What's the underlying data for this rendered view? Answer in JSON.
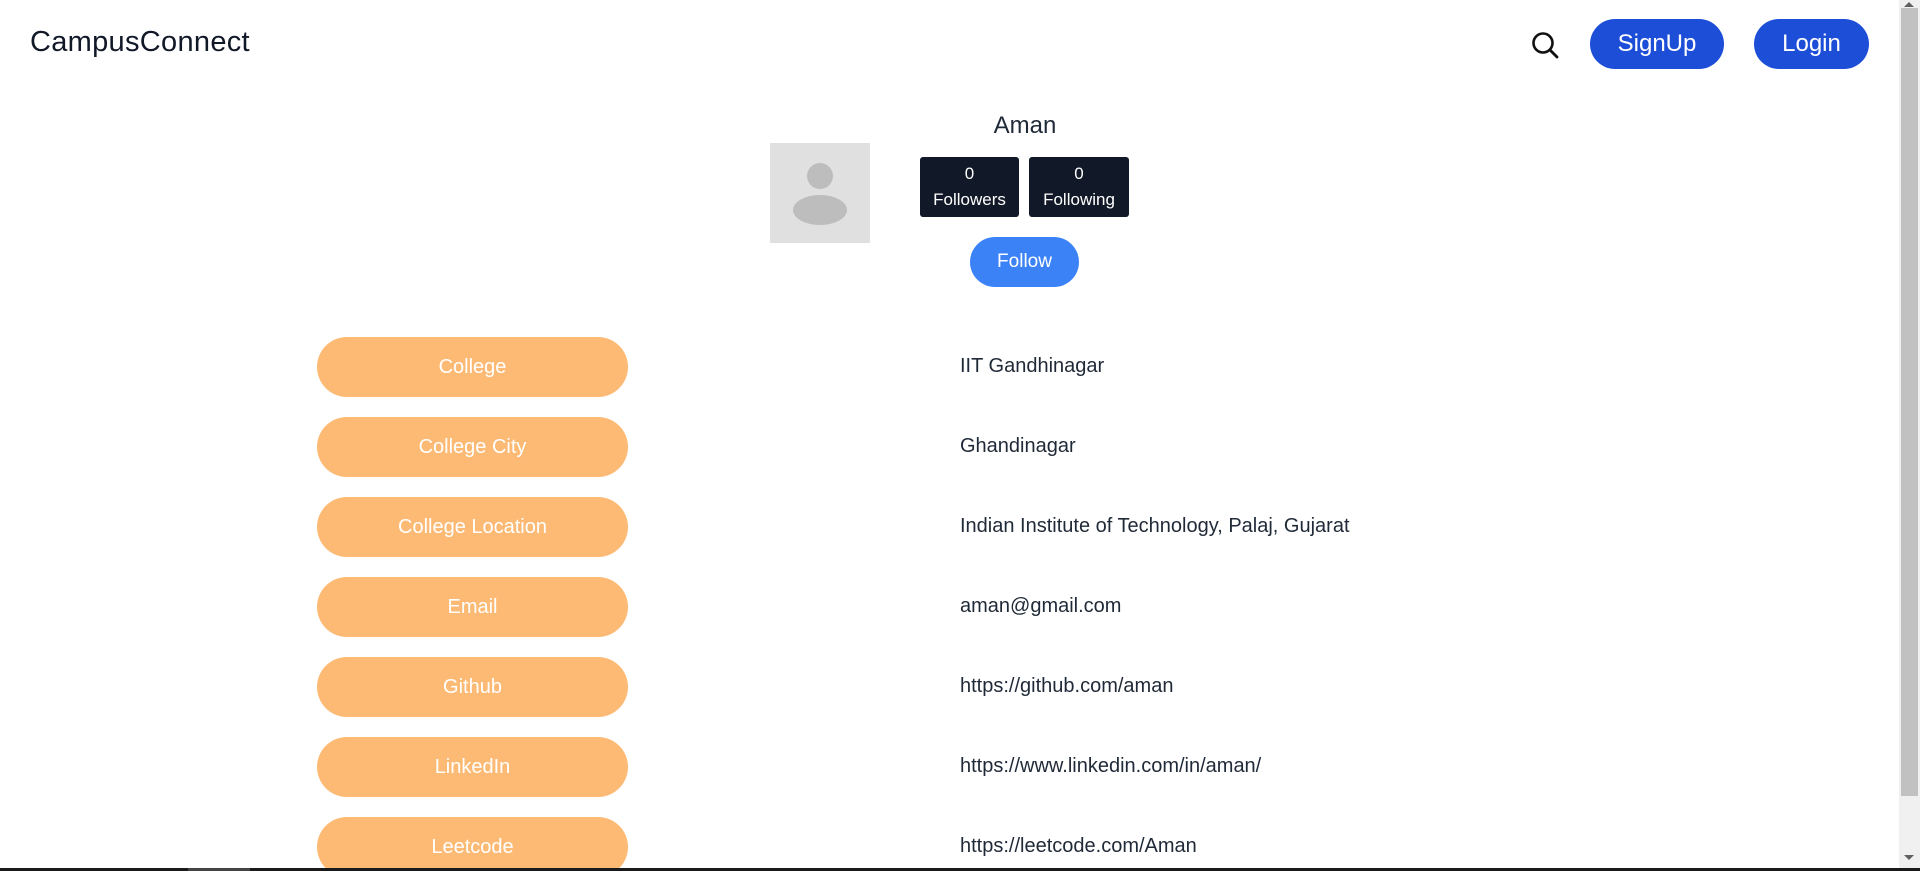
{
  "header": {
    "brand": "CampusConnect",
    "search_icon": "search-icon",
    "signup_label": "SignUp",
    "login_label": "Login"
  },
  "profile": {
    "name": "Aman",
    "avatar_icon": "user-placeholder-icon",
    "followers_count": "0",
    "followers_label": "Followers",
    "following_count": "0",
    "following_label": "Following",
    "follow_label": "Follow"
  },
  "details": [
    {
      "label": "College",
      "value": "IIT Gandhinagar"
    },
    {
      "label": "College City",
      "value": "Ghandinagar"
    },
    {
      "label": "College Location",
      "value": "Indian Institute of Technology, Palaj, Gujarat"
    },
    {
      "label": "Email",
      "value": "aman@gmail.com"
    },
    {
      "label": "Github",
      "value": "https://github.com/aman"
    },
    {
      "label": "LinkedIn",
      "value": "https://www.linkedin.com/in/aman/"
    },
    {
      "label": "Leetcode",
      "value": "https://leetcode.com/Aman"
    }
  ],
  "colors": {
    "nav_button": "#1d4ed8",
    "follow_button": "#3b82f6",
    "stat_box": "#111827",
    "detail_label": "#fdba74"
  }
}
